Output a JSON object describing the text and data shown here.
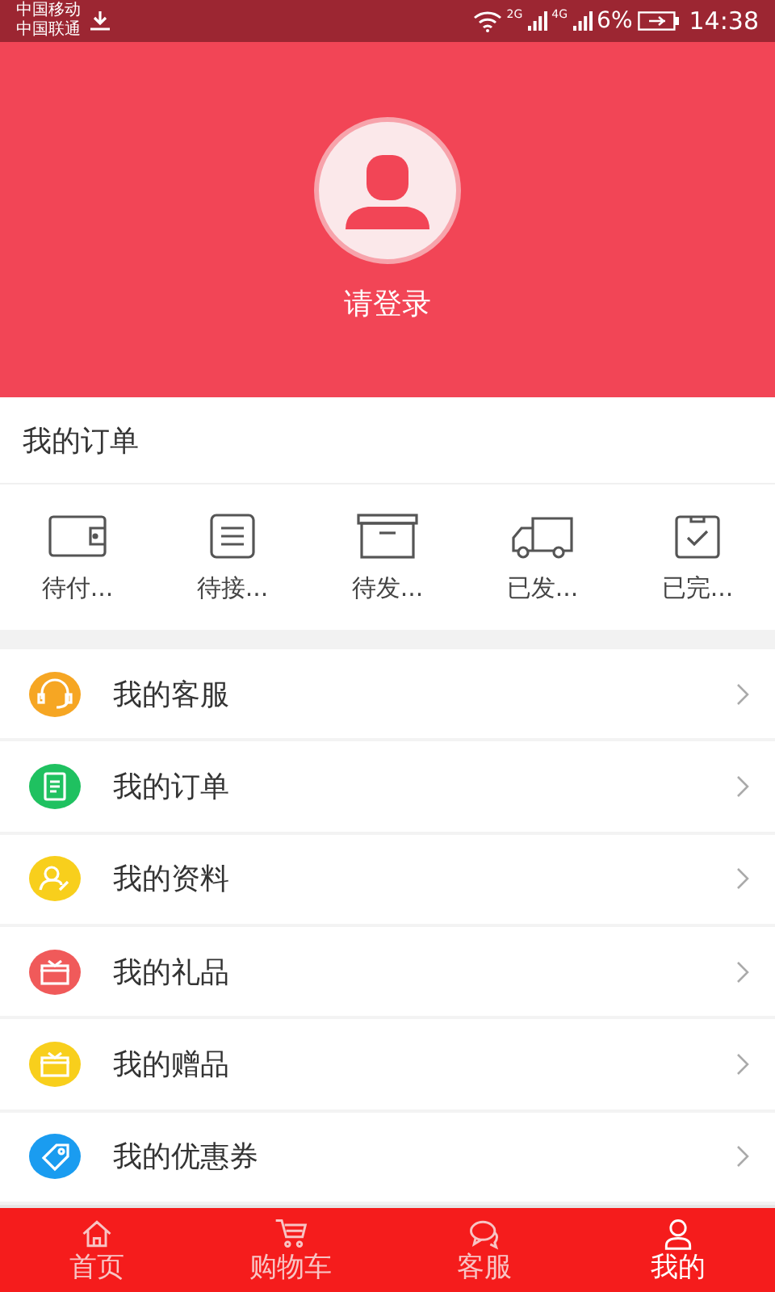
{
  "status_bar": {
    "carriers": [
      "中国移动",
      "中国联通"
    ],
    "network_1": "2G",
    "network_2": "4G",
    "battery": "6%",
    "time": "14:38"
  },
  "profile": {
    "login_text": "请登录"
  },
  "orders": {
    "title": "我的订单",
    "items": [
      {
        "kind": "wallet",
        "label": "待付..."
      },
      {
        "kind": "list",
        "label": "待接..."
      },
      {
        "kind": "box",
        "label": "待发..."
      },
      {
        "kind": "truck",
        "label": "已发..."
      },
      {
        "kind": "check",
        "label": "已完..."
      }
    ]
  },
  "menu": [
    {
      "kind": "headset",
      "label": "我的客服",
      "color": "#f6a623"
    },
    {
      "kind": "note",
      "label": "我的订单",
      "color": "#1fc160"
    },
    {
      "kind": "person",
      "label": "我的资料",
      "color": "#f8cf1c"
    },
    {
      "kind": "gift",
      "label": "我的礼品",
      "color": "#f05a5a"
    },
    {
      "kind": "present",
      "label": "我的赠品",
      "color": "#f8cf1c"
    },
    {
      "kind": "tag",
      "label": "我的优惠券",
      "color": "#1a9cf0"
    }
  ],
  "nav": [
    {
      "kind": "home",
      "label": "首页",
      "selected": false
    },
    {
      "kind": "cart",
      "label": "购物车",
      "selected": false
    },
    {
      "kind": "chat",
      "label": "客服",
      "selected": false
    },
    {
      "kind": "user",
      "label": "我的",
      "selected": true
    }
  ]
}
